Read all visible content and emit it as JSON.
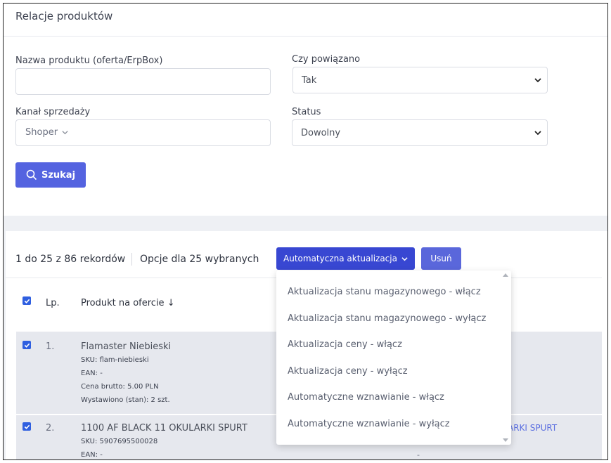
{
  "page": {
    "title": "Relacje produktów"
  },
  "filters": {
    "product_name": {
      "label": "Nazwa produktu (oferta/ErpBox)",
      "value": "",
      "placeholder": ""
    },
    "linked": {
      "label": "Czy powiązano",
      "value": "Tak"
    },
    "channel": {
      "label": "Kanał sprzedaży",
      "value": "Shoper"
    },
    "status": {
      "label": "Status",
      "value": "Dowolny"
    },
    "search_label": "Szukaj"
  },
  "toolbar": {
    "records": "1 do 25 z 86 rekordów",
    "options": "Opcje dla 25 wybranych",
    "auto_update_label": "Automatyczna aktualizacja",
    "delete_label": "Usuń"
  },
  "table": {
    "headers": {
      "lp": "Lp.",
      "product": "Produkt na ofercie ↓"
    },
    "rows": [
      {
        "lp": "1.",
        "name": "Flamaster Niebieski",
        "sku": "SKU: flam-niebieski",
        "ean": "EAN: -",
        "price": "Cena brutto: 5.00 PLN",
        "stock": "Wystawiono (stan): 2 szt."
      },
      {
        "lp": "2.",
        "name": "1100 AF BLACK 11 OKULARKI SPURT",
        "sku": "SKU: 5907695500028",
        "ean": "EAN: -",
        "linked_fragment": "ARKI SPURT",
        "dash": "-"
      }
    ]
  },
  "dropdown": {
    "items": [
      "Aktualizacja stanu magazynowego - włącz",
      "Aktualizacja stanu magazynowego - wyłącz",
      "Aktualizacja ceny - włącz",
      "Aktualizacja ceny - wyłącz",
      "Automatyczne wznawianie - włącz",
      "Automatyczne wznawianie - wyłącz"
    ]
  },
  "colors": {
    "primary": "#3847d2",
    "button": "#5463e0",
    "checkbox": "#2f5fe0",
    "row_selected": "#e6e8ee"
  }
}
